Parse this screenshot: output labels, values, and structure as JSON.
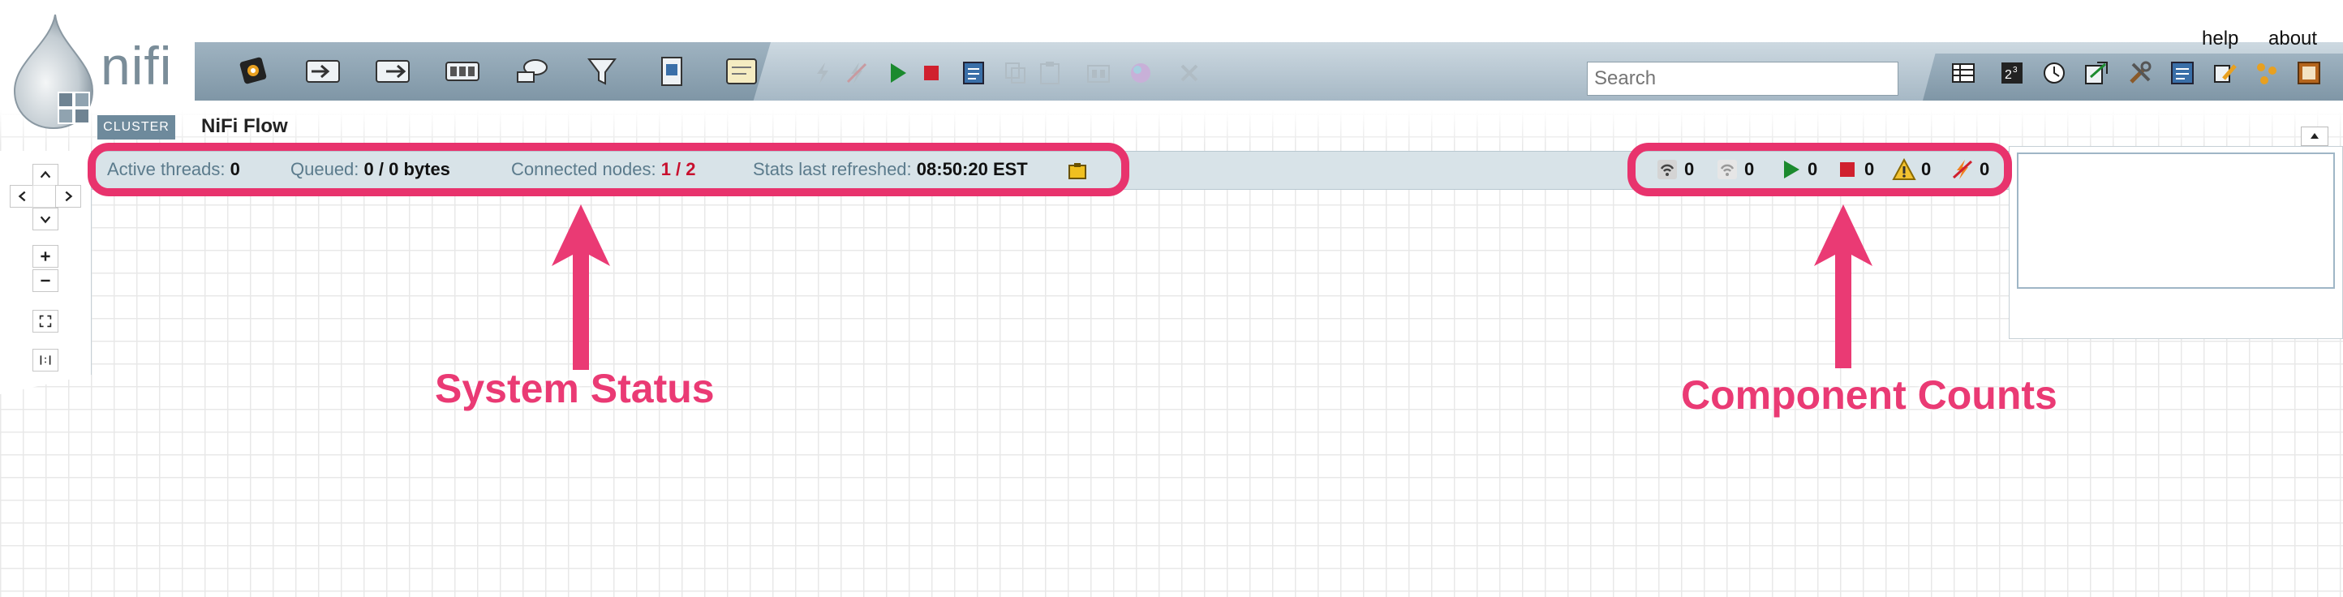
{
  "app": {
    "logo_text": "nifi",
    "cluster_badge": "CLUSTER",
    "flow_title": "NiFi Flow"
  },
  "top_links": {
    "help": "help",
    "about": "about"
  },
  "search": {
    "placeholder": "Search"
  },
  "toolbar": {
    "left_icons": [
      "processor-icon",
      "input-port-icon",
      "output-port-icon",
      "process-group-icon",
      "remote-process-group-icon",
      "funnel-icon",
      "template-icon",
      "label-icon"
    ],
    "action_icons": [
      "enable-icon",
      "disable-icon",
      "start-icon",
      "stop-icon",
      "create-template-icon",
      "copy-icon",
      "paste-icon",
      "group-icon",
      "color-icon",
      "delete-icon"
    ],
    "right_icons": [
      "summary-icon",
      "counters-icon",
      "history-icon",
      "provenance-icon",
      "controller-settings-icon",
      "templates-icon",
      "users-icon",
      "cluster-icon",
      "bulletin-board-icon"
    ]
  },
  "status": {
    "active_threads_label": "Active threads:",
    "active_threads_value": "0",
    "queued_label": "Queued:",
    "queued_value": "0 / 0 bytes",
    "connected_nodes_label": "Connected nodes:",
    "connected_nodes_value": "1 / 2",
    "refreshed_label": "Stats last refreshed:",
    "refreshed_value": "08:50:20 EST"
  },
  "counts": {
    "transmitting": "0",
    "not_transmitting": "0",
    "running": "0",
    "stopped": "0",
    "invalid": "0",
    "disabled": "0"
  },
  "annotations": {
    "system_status": "System Status",
    "component_counts": "Component Counts"
  },
  "colors": {
    "highlight": "#e8336d",
    "accent_red": "#c8102e",
    "toolbar": "#8fa5b4"
  }
}
